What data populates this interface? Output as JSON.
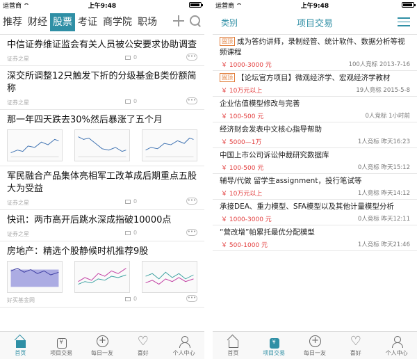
{
  "status": {
    "carrier": "运营商",
    "time": "上午9:48",
    "battery_level": 0.8
  },
  "left": {
    "tabs": [
      "推荐",
      "财经",
      "股票",
      "考证",
      "商学院",
      "职场"
    ],
    "active_tab": "股票",
    "news": [
      {
        "title": "中信证券维证监会有关人员被公安要求协助调查",
        "source": "证券之星",
        "comments": "0"
      },
      {
        "title": "深交所调整12只触发下折的分级基金B类份额简称",
        "source": "证券之星",
        "comments": "0"
      },
      {
        "title": "那一年四天跌去30%然后暴涨了五个月",
        "source": "",
        "comments": ""
      },
      {
        "title": "军民融合产品集体亮相军工改革成后期重点五股大为受益",
        "source": "证券之星",
        "comments": "0"
      },
      {
        "title": "快讯：两市高开后跳水深成指破10000点",
        "source": "证券之星",
        "comments": "0"
      },
      {
        "title": "房地产：精选个股静候时机推荐9股",
        "source": "好买基金网",
        "comments": "0"
      }
    ],
    "tabbar": [
      {
        "label": "首页",
        "icon": "home-icon",
        "active": true
      },
      {
        "label": "项目交易",
        "icon": "bag-icon",
        "active": false
      },
      {
        "label": "每日一友",
        "icon": "plus-circle-icon",
        "active": false
      },
      {
        "label": "喜好",
        "icon": "heart-icon",
        "active": false
      },
      {
        "label": "个人中心",
        "icon": "person-icon",
        "active": false
      }
    ]
  },
  "right": {
    "category": "类别",
    "title": "项目交易",
    "tasks": [
      {
        "badge": "固顶",
        "title": "成为答约讲师，录制经管、统计软件、数据分析等视频课程",
        "price": "￥ 1000-3000 元",
        "info": "100人竞标 2013-7-16"
      },
      {
        "badge": "固顶",
        "title": "【论坛官方项目】微观经济学、宏观经济学教材",
        "price": "￥ 10万元以上",
        "info": "19人竞标 2015-5-8"
      },
      {
        "badge": "",
        "title": "企业估值模型修改与完善",
        "price": "￥ 100-500 元",
        "info": "0人竞标 1小时前"
      },
      {
        "badge": "",
        "title": "经济财会发表中文核心指导帮助",
        "price": "￥ 5000—1万",
        "info": "1人竞标 昨天16:23"
      },
      {
        "badge": "",
        "title": "中国上市公司诉讼仲裁研究数据库",
        "price": "￥ 100-500 元",
        "info": "0人竞标 昨天15:12"
      },
      {
        "badge": "",
        "title": "辅导/代做 留学生assignment，投行笔试等",
        "price": "￥ 10万元以上",
        "info": "1人竞标 昨天14:12"
      },
      {
        "badge": "",
        "title": "承接DEA、重力模型、SFA模型以及其他计量模型分析",
        "price": "￥ 1000-3000 元",
        "info": "0人竞标 昨天12:11"
      },
      {
        "badge": "",
        "title": "“营改增”帕累托最优分配模型",
        "price": "￥ 500-1000 元",
        "info": "1人竞标 昨天21:46"
      }
    ],
    "tabbar": [
      {
        "label": "首页",
        "icon": "home-icon",
        "active": false
      },
      {
        "label": "项目交易",
        "icon": "bag-icon",
        "active": true
      },
      {
        "label": "每日一友",
        "icon": "plus-circle-icon",
        "active": false
      },
      {
        "label": "喜好",
        "icon": "heart-icon",
        "active": false
      },
      {
        "label": "个人中心",
        "icon": "person-icon",
        "active": false
      }
    ]
  },
  "colors": {
    "accent": "#2f8fa5",
    "price": "#e23b3b",
    "badge": "#e07a35"
  }
}
